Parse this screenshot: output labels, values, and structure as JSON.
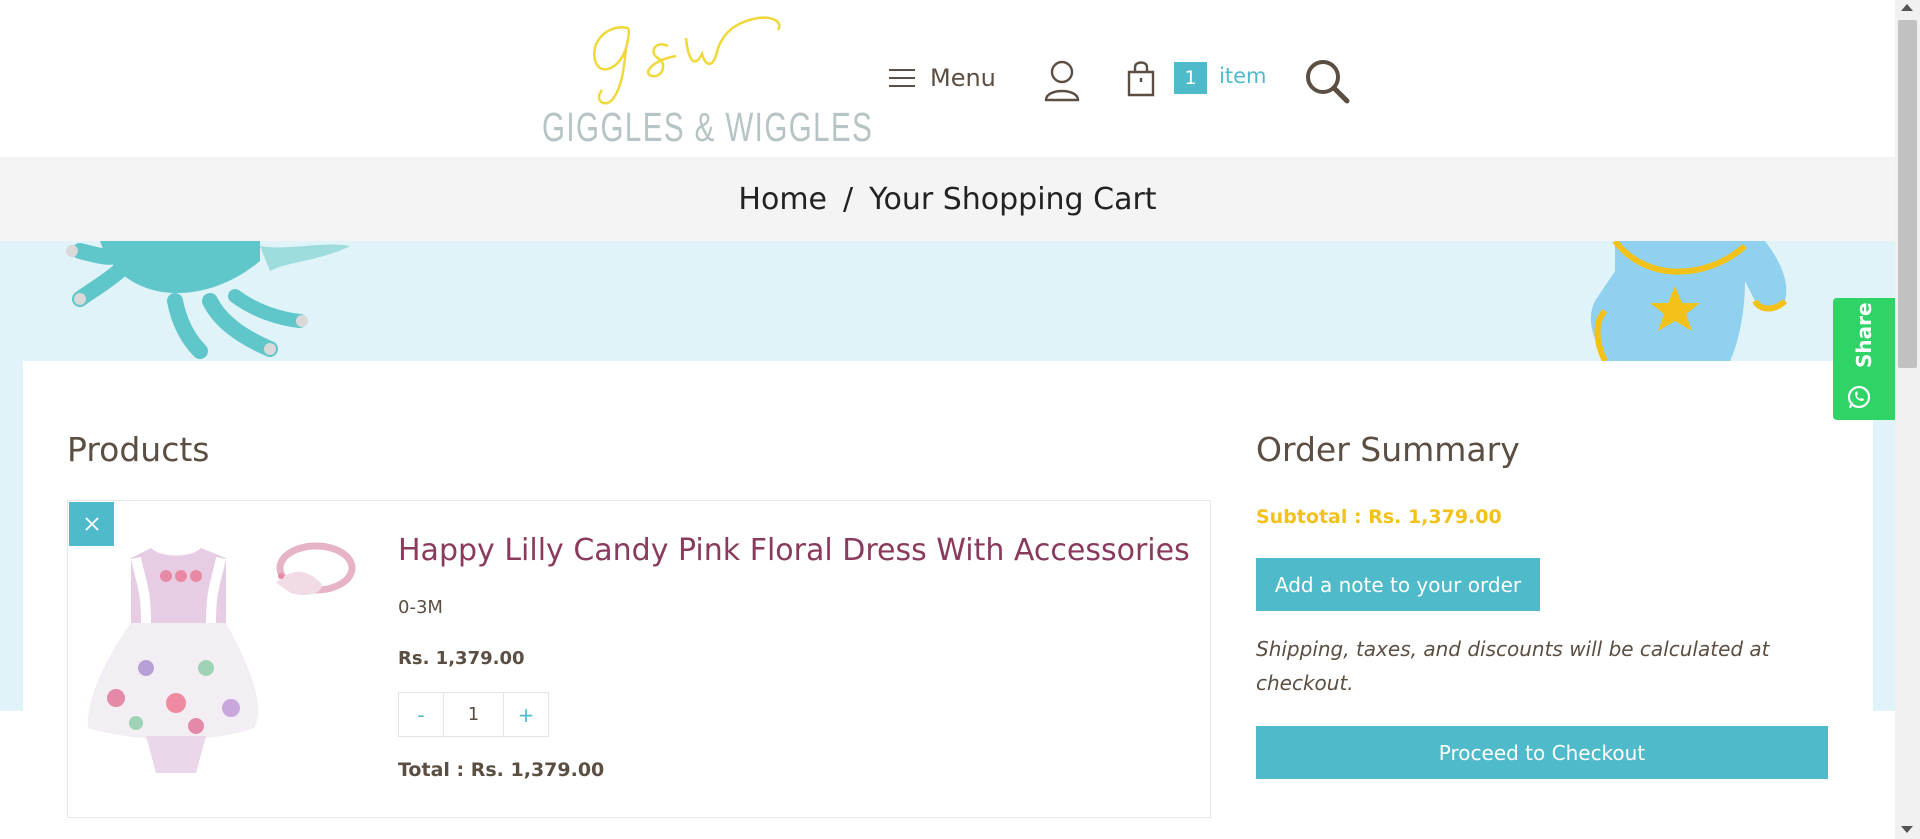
{
  "brand": {
    "logo_script": "g&w",
    "logo_name": "GIGGLES & WIGGLES"
  },
  "nav": {
    "menu_label": "Menu",
    "cart_count": "1",
    "cart_label": "item"
  },
  "breadcrumb": {
    "home": "Home",
    "separator": "/",
    "current": "Your Shopping Cart"
  },
  "products": {
    "heading": "Products",
    "items": [
      {
        "title": "Happy Lilly Candy Pink Floral Dress With Accessories",
        "variant": "0-3M",
        "price": "Rs. 1,379.00",
        "quantity": "1",
        "minus_label": "-",
        "plus_label": "+",
        "total": "Total : Rs. 1,379.00"
      }
    ]
  },
  "summary": {
    "heading": "Order Summary",
    "subtotal": "Subtotal : Rs. 1,379.00",
    "note_button": "Add a note to your order",
    "shipping_note": "Shipping, taxes, and discounts will be calculated at checkout.",
    "checkout_button": "Proceed to Checkout"
  },
  "share": {
    "label": "Share"
  },
  "colors": {
    "accent": "#4fbac9",
    "subtotal": "#f2c21b",
    "product_title": "#8a3a5c",
    "share_green": "#2fd366",
    "banner_bg": "#e0f3f9"
  }
}
